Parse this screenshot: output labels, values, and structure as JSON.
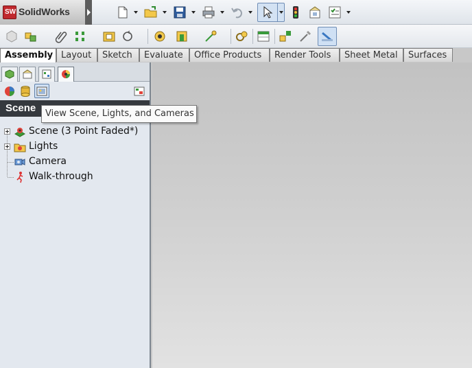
{
  "app": {
    "logo_badge": "SW",
    "logo_text": "SolidWorks"
  },
  "top_toolbar": {
    "icons": [
      "new-document-icon",
      "open-folder-icon",
      "save-icon",
      "print-icon",
      "undo-icon",
      "select-pointer-icon",
      "traffic-light-icon",
      "options-icon",
      "customize-icon"
    ]
  },
  "command_tabs": [
    {
      "label": "Assembly",
      "active": true
    },
    {
      "label": "Layout",
      "active": false
    },
    {
      "label": "Sketch",
      "active": false
    },
    {
      "label": "Evaluate",
      "active": false
    },
    {
      "label": "Office Products",
      "active": false
    },
    {
      "label": "Render Tools",
      "active": false
    },
    {
      "label": "Sheet Metal",
      "active": false
    },
    {
      "label": "Surfaces",
      "active": false
    }
  ],
  "panel": {
    "header": "Scene",
    "tooltip": "View Scene, Lights, and Cameras",
    "tree": [
      {
        "label": "Scene (3 Point Faded*)",
        "expandable": true
      },
      {
        "label": "Lights",
        "expandable": true
      },
      {
        "label": "Camera",
        "expandable": false
      },
      {
        "label": "Walk-through",
        "expandable": false
      }
    ]
  },
  "colors": {
    "accent": "#c0282d",
    "panel_header": "#35393e",
    "viewport_top": "#c2c2c2",
    "viewport_bottom": "#e2e2e2"
  }
}
